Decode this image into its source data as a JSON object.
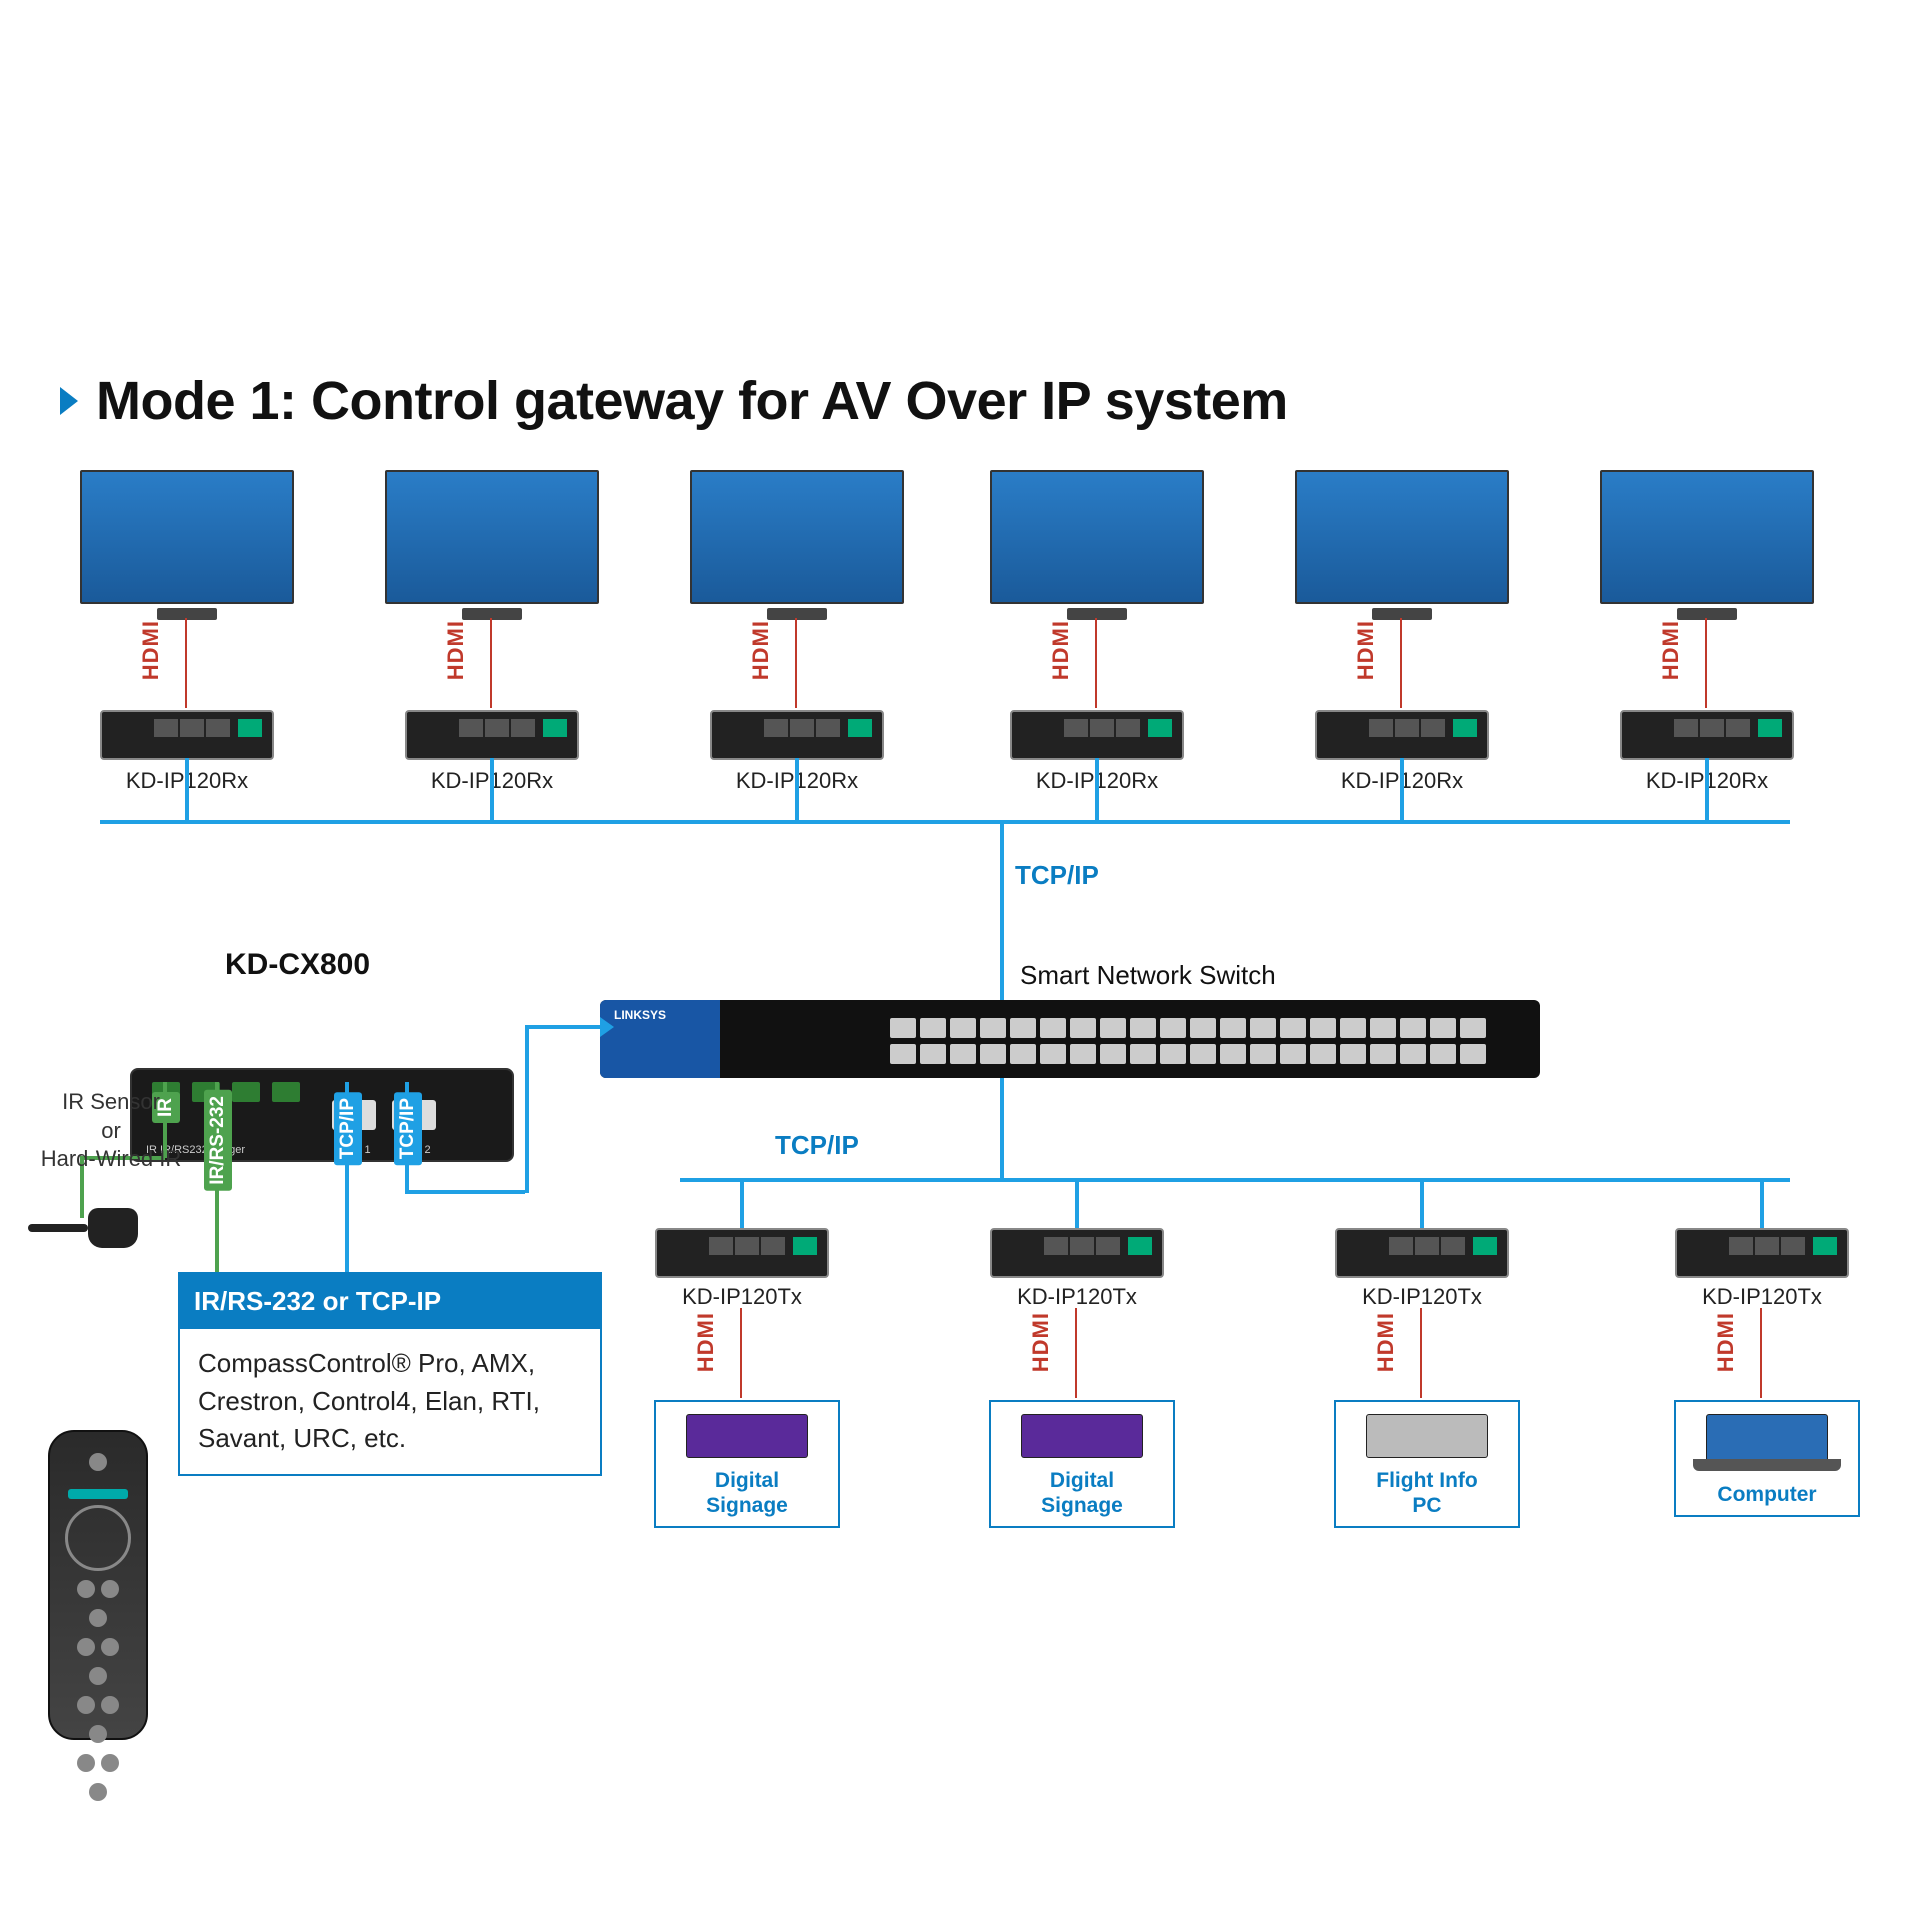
{
  "title": "Mode 1: Control gateway for AV Over IP system",
  "hdmi_label": "HDMI",
  "tcpip_label": "TCP/IP",
  "rx_label": "KD-IP120Rx",
  "rx_count": 6,
  "cx800": {
    "title": "KD-CX800",
    "port_tags": {
      "ir": "IR",
      "irrs232": "IR/RS-232",
      "tcpip": "TCP/IP"
    }
  },
  "sensor_label": "IR Sensor\nor\nHard-Wired IR",
  "control_box": {
    "heading": "IR/RS-232 or TCP-IP",
    "body": "CompassControl® Pro,  AMX, Crestron, Control4, Elan, RTI, Savant, URC, etc."
  },
  "switch": {
    "label": "Smart Network Switch",
    "brand": "LINKSYS"
  },
  "tx_label": "KD-IP120Tx",
  "tx_count": 4,
  "sources": [
    {
      "caption": "Digital\nSignage",
      "kind": "signage"
    },
    {
      "caption": "Digital\nSignage",
      "kind": "signage"
    },
    {
      "caption": "Flight Info\nPC",
      "kind": "pc"
    },
    {
      "caption": "Computer",
      "kind": "laptop"
    }
  ]
}
